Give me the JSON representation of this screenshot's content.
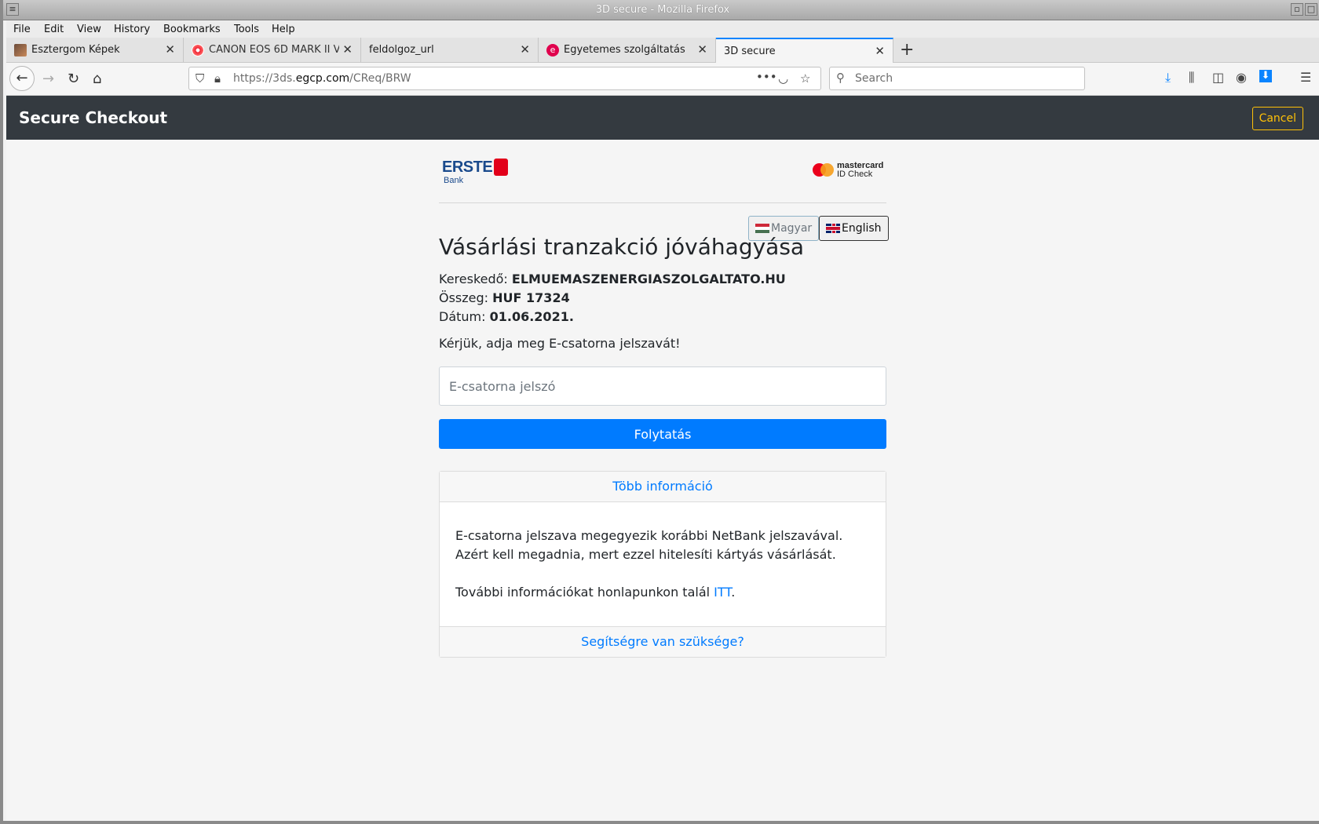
{
  "window": {
    "title": "3D secure - Mozilla Firefox"
  },
  "menu": [
    "File",
    "Edit",
    "View",
    "History",
    "Bookmarks",
    "Tools",
    "Help"
  ],
  "tabs": [
    {
      "label": "Esztergom Képek"
    },
    {
      "label": "CANON EOS 6D MARK II V"
    },
    {
      "label": "feldolgoz_url"
    },
    {
      "label": "Egyetemes szolgáltatás"
    },
    {
      "label": "3D secure"
    }
  ],
  "nav": {
    "url_prefix": "https://3ds.",
    "url_domain": "egcp.com",
    "url_path": "/CReq/BRW",
    "search_placeholder": "Search"
  },
  "page": {
    "brand": "Secure Checkout",
    "cancel": "Cancel",
    "bank_logo": "ERSTE",
    "bank_sub": "Bank",
    "mc_logo_top": "mastercard",
    "mc_logo_bottom": "ID Check",
    "lang_hu": "Magyar",
    "lang_en": "English",
    "heading": "Vásárlási tranzakció jóváhagyása",
    "merchant_label": "Kereskedő:",
    "merchant_value": "ELMUEMASZENERGIASZOLGALTATO.HU",
    "amount_label": "Összeg:",
    "amount_value": "HUF 17324",
    "date_label": "Dátum:",
    "date_value": "01.06.2021.",
    "prompt": "Kérjük, adja meg E-csatorna jelszavát!",
    "password_placeholder": "E-csatorna jelszó",
    "continue": "Folytatás",
    "more_info": "Több információ",
    "info_text": "E-csatorna jelszava megegyezik korábbi NetBank jelszavával. Azért kell megadnia, mert ezzel hitelesíti kártyás vásárlását.",
    "info_more_prefix": "További információkat honlapunkon talál ",
    "info_more_link": "ITT",
    "info_more_suffix": ".",
    "help": "Segítségre van szüksége?"
  }
}
